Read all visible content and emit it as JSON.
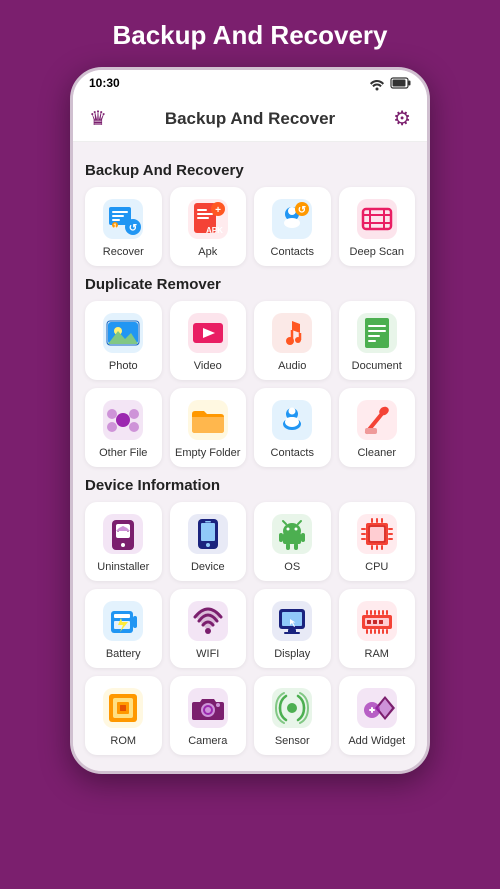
{
  "page": {
    "title": "Backup And Recovery",
    "status_time": "10:30"
  },
  "header": {
    "title": "Backup And Recover",
    "settings_label": "Settings"
  },
  "sections": [
    {
      "id": "backup",
      "title": "Backup And Recovery",
      "items": [
        {
          "id": "recover",
          "label": "Recover",
          "color": "#2196F3"
        },
        {
          "id": "apk",
          "label": "Apk",
          "color": "#F44336"
        },
        {
          "id": "contacts-backup",
          "label": "Contacts",
          "color": "#2196F3"
        },
        {
          "id": "deep-scan",
          "label": "Deep Scan",
          "color": "#E91E63"
        }
      ]
    },
    {
      "id": "duplicate",
      "title": "Duplicate Remover",
      "items": [
        {
          "id": "photo",
          "label": "Photo",
          "color": "#2196F3"
        },
        {
          "id": "video",
          "label": "Video",
          "color": "#E91E63"
        },
        {
          "id": "audio",
          "label": "Audio",
          "color": "#FF5722"
        },
        {
          "id": "document",
          "label": "Document",
          "color": "#4CAF50"
        },
        {
          "id": "other-file",
          "label": "Other File",
          "color": "#9C27B0"
        },
        {
          "id": "empty-folder",
          "label": "Empty Folder",
          "color": "#FF9800"
        },
        {
          "id": "contacts-dup",
          "label": "Contacts",
          "color": "#2196F3"
        },
        {
          "id": "cleaner",
          "label": "Cleaner",
          "color": "#F44336"
        }
      ]
    },
    {
      "id": "device",
      "title": "Device Information",
      "items": [
        {
          "id": "uninstaller",
          "label": "Uninstaller",
          "color": "#7B1F6E"
        },
        {
          "id": "device",
          "label": "Device",
          "color": "#1A237E"
        },
        {
          "id": "os",
          "label": "OS",
          "color": "#4CAF50"
        },
        {
          "id": "cpu",
          "label": "CPU",
          "color": "#F44336"
        },
        {
          "id": "battery",
          "label": "Battery",
          "color": "#2196F3"
        },
        {
          "id": "wifi",
          "label": "WIFI",
          "color": "#7B1F6E"
        },
        {
          "id": "display",
          "label": "Display",
          "color": "#1A237E"
        },
        {
          "id": "ram",
          "label": "RAM",
          "color": "#F44336"
        },
        {
          "id": "rom",
          "label": "ROM",
          "color": "#FF9800"
        },
        {
          "id": "camera",
          "label": "Camera",
          "color": "#7B1F6E"
        },
        {
          "id": "sensor",
          "label": "Sensor",
          "color": "#4CAF50"
        },
        {
          "id": "add-widget",
          "label": "Add Widget",
          "color": "#7B1F6E"
        }
      ]
    }
  ]
}
